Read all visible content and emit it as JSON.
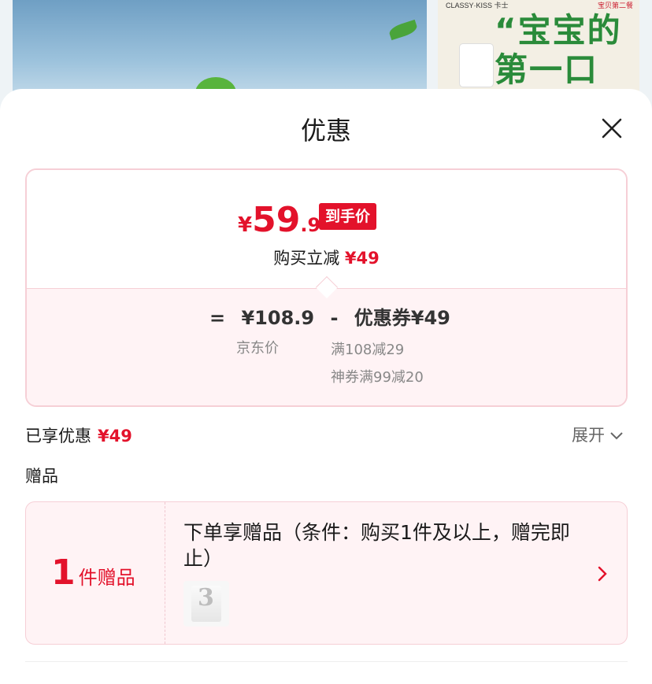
{
  "background": {
    "brand_left": "CLASSY·KISS 卡士",
    "brand_right": "宝贝第二餐",
    "slogan_line1": "“宝宝的",
    "slogan_line2": "第一口"
  },
  "sheet": {
    "title": "优惠",
    "close_icon": "close-icon"
  },
  "price_card": {
    "currency": "¥",
    "final_int": "59",
    "final_dec": ".9",
    "tag": "到手价",
    "buy_reduce_label": "购买立减",
    "buy_reduce_amount": "¥49",
    "calc": {
      "equals": "=",
      "jd_price": "¥108.9",
      "minus": "-",
      "coupon_text": "优惠券¥49",
      "jd_label": "京东价",
      "coupon_1": "满108减29",
      "coupon_2": "神券满99减20"
    }
  },
  "enjoyed": {
    "label": "已享优惠",
    "amount": "¥49",
    "expand_label": "展开"
  },
  "gift": {
    "section_title": "赠品",
    "count": "1",
    "count_unit": "件赠品",
    "description": "下单享赠品（条件：购买1件及以上，赠完即止）",
    "arrow_icon": "chevron-right-icon"
  },
  "colors": {
    "accent": "#e3122b",
    "card_border": "#f6cfd6",
    "card_bg": "#fff3f5"
  }
}
